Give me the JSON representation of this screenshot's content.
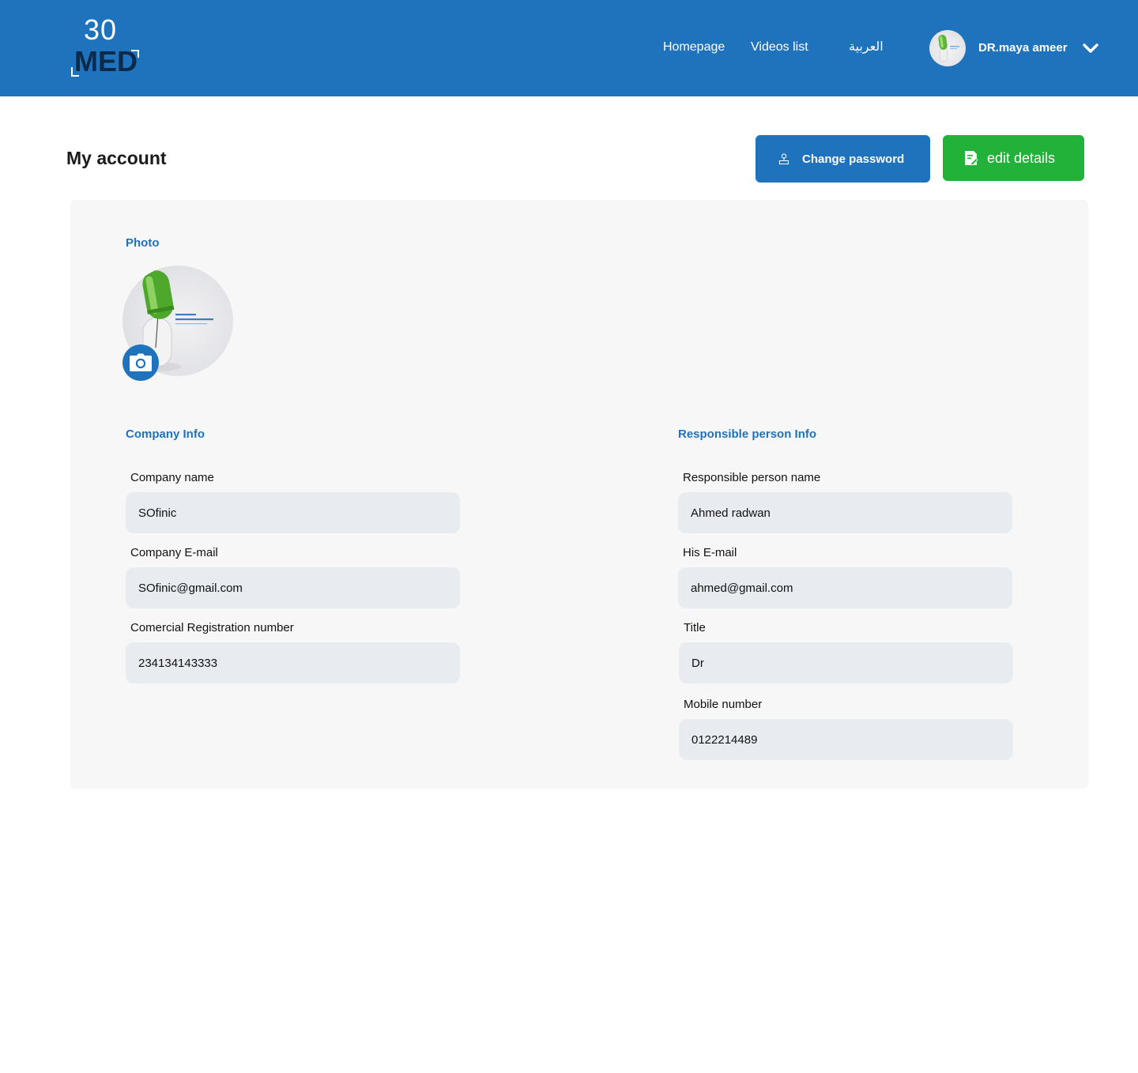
{
  "header": {
    "logo_number": "30",
    "logo_word": "MED",
    "nav": [
      {
        "label": "Homepage"
      },
      {
        "label": "Videos list"
      },
      {
        "label": "العربية"
      }
    ],
    "user": {
      "name": "DR.maya ameer"
    }
  },
  "main": {
    "title": "My account",
    "buttons": {
      "change_password": "Change password",
      "edit_details": "edit details"
    },
    "photo": {
      "title": "Photo"
    },
    "company": {
      "title": "Company Info",
      "fields": [
        {
          "label": "Company name",
          "value": "SOfinic"
        },
        {
          "label": "Company E-mail",
          "value": "SOfinic@gmail.com"
        },
        {
          "label": "Comercial Registration number",
          "value": "234134143333"
        }
      ]
    },
    "person": {
      "title": "Responsible person Info",
      "fields": [
        {
          "label": "Responsible person name",
          "value": "Ahmed radwan"
        },
        {
          "label": "His E-mail",
          "value": "ahmed@gmail.com"
        },
        {
          "label": "Title",
          "value": "Dr"
        },
        {
          "label": "Mobile number",
          "value": "0122214489"
        }
      ]
    }
  },
  "colors": {
    "primary": "#1f73bd",
    "success": "#22b23a",
    "card_bg": "#f7f7f7",
    "input_bg": "#e8ecf0"
  }
}
